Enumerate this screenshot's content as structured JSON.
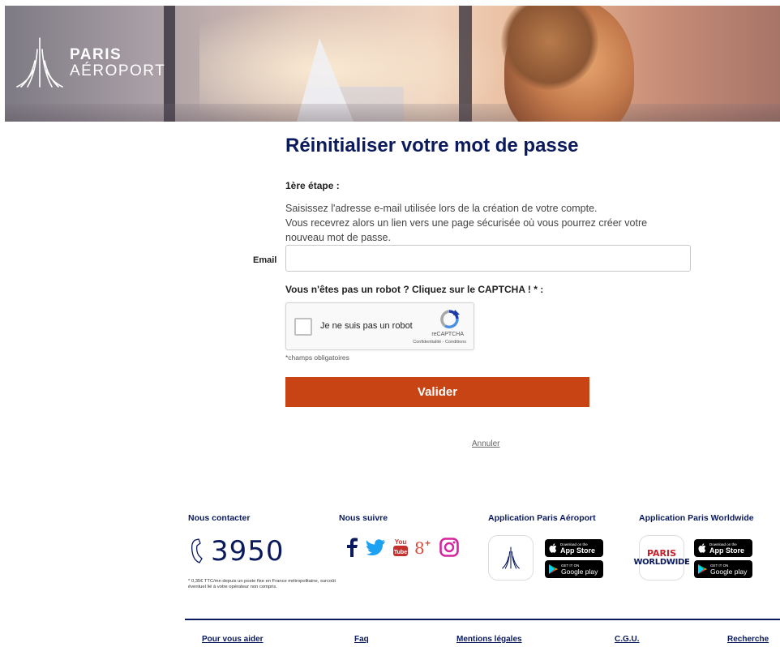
{
  "brand": {
    "line1": "PARIS",
    "line2": "AÉROPORT"
  },
  "form": {
    "title": "Réinitialiser votre mot de passe",
    "step": "1ère étape :",
    "description": [
      "Saisissez l'adresse e-mail utilisée lors de la création de votre compte.",
      "Vous recevrez alors un lien vers une page sécurisée où vous pourrez créer votre",
      "nouveau mot de passe."
    ],
    "email_label": "Email",
    "email_value": "",
    "captcha_title": "Vous n'êtes pas un robot ? Cliquez sur le CAPTCHA ! * :",
    "recaptcha": {
      "label": "Je ne suis pas un robot",
      "brand": "reCAPTCHA",
      "links": "Confidentialité - Conditions",
      "checked": false
    },
    "required_note": "*champs obligatoires",
    "submit_label": "Valider",
    "cancel_label": "Annuler"
  },
  "footer": {
    "contact_title": "Nous contacter",
    "phone_number": "3950",
    "price_note": "* 0,35€ TTC/mn depuis un poste fixe en France métropolitaine, surcoût éventuel lié à votre opérateur non compris.",
    "follow_title": "Nous suivre",
    "socials": [
      "facebook-icon",
      "twitter-icon",
      "youtube-icon",
      "google-plus-icon",
      "instagram-icon"
    ],
    "app_pa_title": "Application Paris Aéroport",
    "app_pw_title": "Application Paris Worldwide",
    "pw_logo": {
      "line1": "PARIS",
      "line2": "WORLDWIDE"
    },
    "app_store": {
      "small": "Download on the",
      "big": "App Store"
    },
    "google_play": {
      "small": "GET IT ON",
      "big": "Google play"
    },
    "bottom_nav": [
      "Pour vous aider",
      "Faq",
      "Mentions légales",
      "C.G.U.",
      "Recherche"
    ]
  },
  "colors": {
    "navy": "#0a1a5c",
    "accent": "#c84415"
  }
}
